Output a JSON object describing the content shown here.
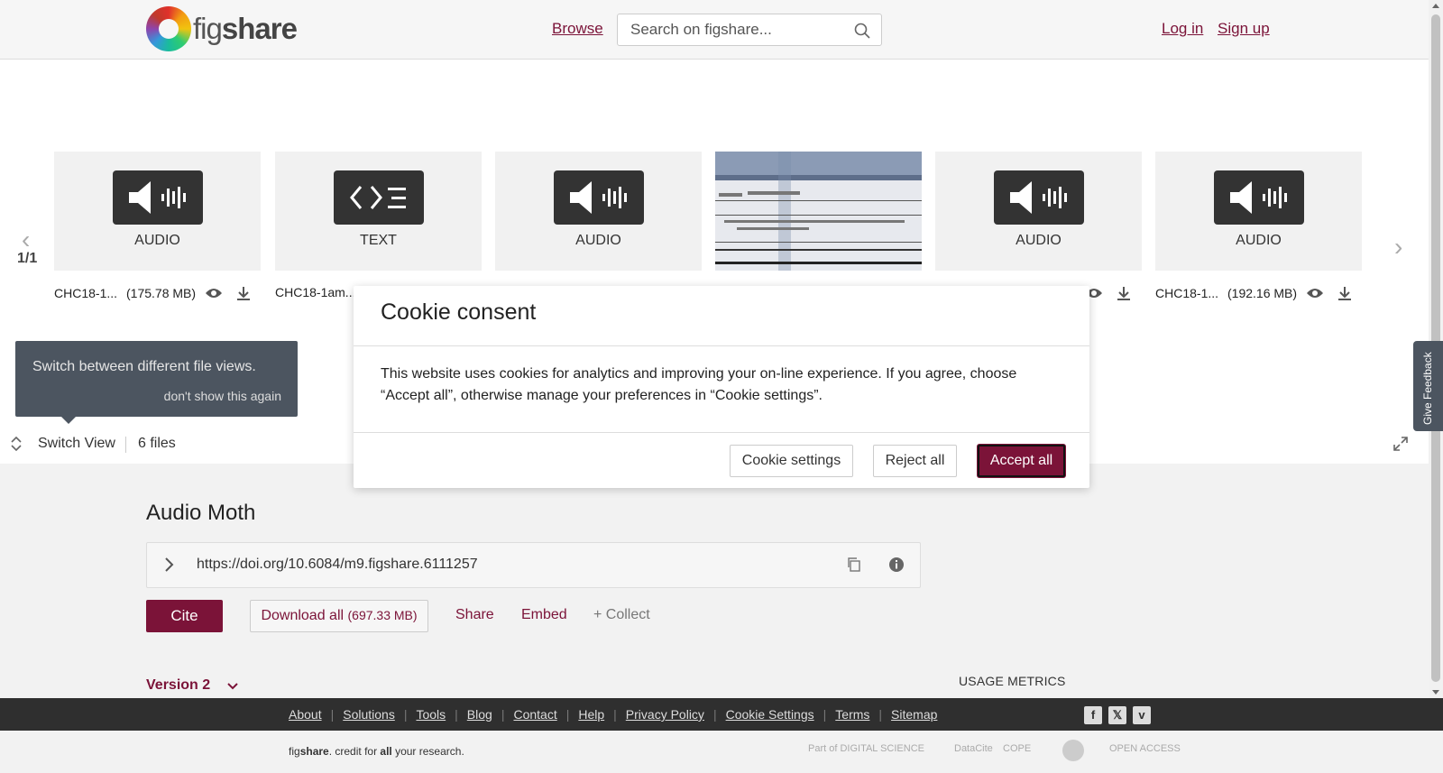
{
  "header": {
    "logo_prefix": "fig",
    "logo_suffix": "share",
    "browse_label": "Browse",
    "search_placeholder": "Search on figshare...",
    "login_label": "Log in",
    "signup_label": "Sign up"
  },
  "carousel": {
    "page": "1/1",
    "tiles": [
      {
        "type": "AUDIO",
        "name": "CHC18-1...",
        "size": "(175.78 MB)"
      },
      {
        "type": "TEXT",
        "name": "CHC18-1am...",
        "size": ""
      },
      {
        "type": "AUDIO",
        "name": "",
        "size": ""
      },
      {
        "type": "",
        "name": "",
        "size": ""
      },
      {
        "type": "AUDIO",
        "name": "",
        "size": ""
      },
      {
        "type": "AUDIO",
        "name": "CHC18-1...",
        "size": "(192.16 MB)"
      }
    ]
  },
  "tooltip": {
    "text": "Switch between different file views.",
    "dismiss": "don't show this again"
  },
  "switch_view": {
    "label": "Switch View",
    "file_count": "6 files"
  },
  "item": {
    "title": "Audio Moth",
    "doi": "https://doi.org/10.6084/m9.figshare.6111257",
    "cite_label": "Cite",
    "download_label": "Download all",
    "download_size": "(697.33 MB)",
    "share_label": "Share",
    "embed_label": "Embed",
    "collect_label": "+ Collect",
    "version_label": "Version 2",
    "usage_label": "USAGE METRICS"
  },
  "feedback_label": "Give Feedback",
  "footer": {
    "links": [
      "About",
      "Solutions",
      "Tools",
      "Blog",
      "Contact",
      "Help",
      "Privacy Policy",
      "Cookie Settings",
      "Terms",
      "Sitemap"
    ],
    "tagline_prefix": "fig",
    "tagline_brand": "share",
    "tagline_middle": ". credit for ",
    "tagline_bold": "all",
    "tagline_end": " your research.",
    "partners": [
      "Part of DIGITAL SCIENCE",
      "DataCite",
      "COPE",
      "",
      "OPEN ACCESS"
    ]
  },
  "cookie_modal": {
    "title": "Cookie consent",
    "body": "This website uses cookies for analytics and improving your on-line experience. If you agree, choose “Accept all”, otherwise manage your preferences in “Cookie settings”.",
    "settings_label": "Cookie settings",
    "reject_label": "Reject all",
    "accept_label": "Accept all"
  },
  "colors": {
    "brand": "#7b1338",
    "footer_dark": "#2f2f2f",
    "tooltip_bg": "#4c5560"
  }
}
